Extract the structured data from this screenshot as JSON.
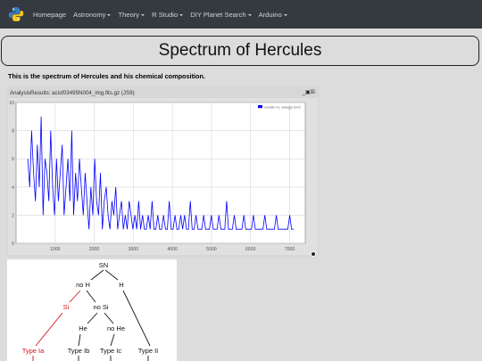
{
  "navbar": {
    "logo_icon": "python-logo-icon",
    "items": [
      {
        "label": "Homepage",
        "dropdown": false
      },
      {
        "label": "Astronomy",
        "dropdown": true
      },
      {
        "label": "Theory",
        "dropdown": true
      },
      {
        "label": "R Studio",
        "dropdown": true
      },
      {
        "label": "DIY Planet Search",
        "dropdown": true
      },
      {
        "label": "Arduino",
        "dropdown": true
      }
    ]
  },
  "page": {
    "title": "Spectrum of Hercules",
    "intro": "This is the spectrum of Hercules and his chemical composition."
  },
  "js9": {
    "window_title": "AnalysisResults: acisf03495N004_img.fits.gz (JS9)",
    "controls": "_▣☒",
    "settings_icon": "gear-icon"
  },
  "chart_data": {
    "type": "line",
    "legend": "counts vs. energy (ev)",
    "legend_position": "top-right",
    "color": "#0000ff",
    "xlim": [
      0,
      7400
    ],
    "ylim": [
      0,
      10
    ],
    "x_ticks": [
      "1000",
      "2000",
      "3000",
      "4000",
      "5000",
      "6000",
      "7000"
    ],
    "y_ticks": [
      "0",
      "2",
      "4",
      "6",
      "8",
      "10"
    ],
    "grid": true,
    "series": [
      {
        "x_start": 300,
        "x_step": 50,
        "values": [
          6,
          4,
          8,
          5,
          3,
          7,
          4,
          9,
          2,
          6,
          5,
          3,
          8,
          4,
          2,
          6,
          3,
          5,
          7,
          2,
          4,
          6,
          3,
          8,
          2,
          5,
          3,
          6,
          4,
          2,
          5,
          3,
          1,
          4,
          2,
          6,
          3,
          2,
          5,
          1,
          3,
          4,
          2,
          1,
          3,
          2,
          4,
          1,
          2,
          3,
          1,
          2,
          1,
          3,
          2,
          1,
          2,
          1,
          3,
          1,
          2,
          1,
          1,
          2,
          1,
          3,
          1,
          1,
          2,
          1,
          1,
          2,
          1,
          1,
          3,
          1,
          1,
          2,
          1,
          1,
          2,
          1,
          2,
          1,
          1,
          3,
          1,
          1,
          2,
          1,
          1,
          1,
          2,
          1,
          1,
          1,
          2,
          1,
          1,
          1,
          2,
          1,
          1,
          1,
          3,
          1,
          1,
          1,
          2,
          1,
          1,
          1,
          1,
          2,
          1,
          1,
          1,
          1,
          2,
          1,
          1,
          1,
          1,
          1,
          2,
          1,
          1,
          1,
          1,
          1,
          2,
          1,
          1,
          1,
          1,
          1,
          1,
          2,
          1,
          1,
          1,
          1,
          1,
          1,
          1,
          2,
          1,
          1,
          1
        ]
      }
    ]
  },
  "sn_diagram": {
    "nodes": [
      {
        "id": "sn",
        "label": "SN",
        "color": "#111111"
      },
      {
        "id": "noh",
        "label": "no H",
        "color": "#111111"
      },
      {
        "id": "h",
        "label": "H",
        "color": "#111111"
      },
      {
        "id": "si",
        "label": "Si",
        "color": "#d0141b"
      },
      {
        "id": "nosi",
        "label": "no Si",
        "color": "#111111"
      },
      {
        "id": "he",
        "label": "He",
        "color": "#111111"
      },
      {
        "id": "nohe",
        "label": "no He",
        "color": "#111111"
      },
      {
        "id": "ia",
        "label": "Type Ia",
        "color": "#d0141b"
      },
      {
        "id": "ib",
        "label": "Type Ib",
        "color": "#111111"
      },
      {
        "id": "ic",
        "label": "Type Ic",
        "color": "#111111"
      },
      {
        "id": "ii",
        "label": "Type II",
        "color": "#111111"
      }
    ]
  }
}
